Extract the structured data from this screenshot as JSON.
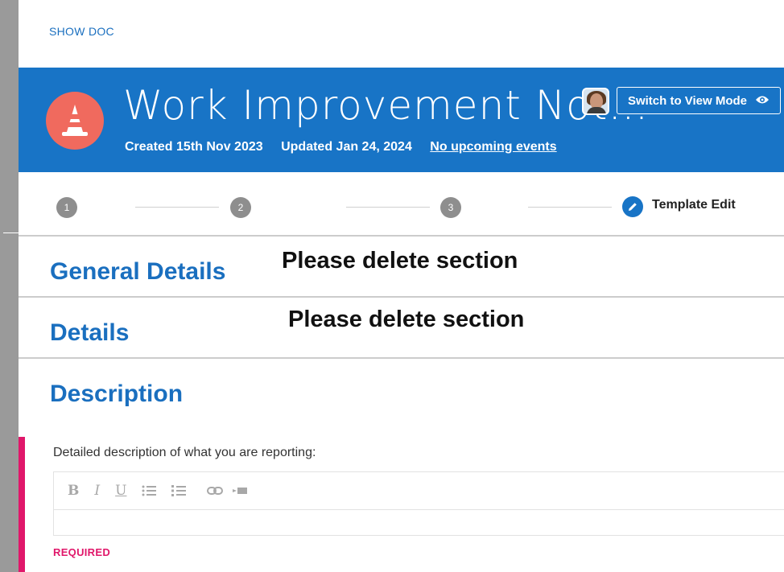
{
  "nav": {
    "show_doc": "SHOW DOC"
  },
  "header": {
    "title": "Work Improvement Not…",
    "created": "Created 15th Nov 2023",
    "updated": "Updated Jan 24, 2024",
    "events_link": "No upcoming events",
    "switch_button": "Switch to View Mode",
    "icon": "traffic-cone-icon",
    "colors": {
      "banner": "#1874c6",
      "icon_bg": "#f06a5e"
    }
  },
  "stepper": {
    "steps": [
      "1",
      "2",
      "3"
    ],
    "active_label": "Template Edit"
  },
  "sections": [
    {
      "title": "General Details",
      "note": "Please delete section"
    },
    {
      "title": "Details",
      "note": "Please delete section"
    },
    {
      "title": "Description"
    }
  ],
  "field": {
    "label": "Detailed description of what you are reporting:",
    "value": "",
    "required_label": "REQUIRED",
    "toolbar": [
      "bold",
      "italic",
      "underline",
      "bullet-list",
      "numbered-list",
      "link",
      "embed"
    ]
  }
}
